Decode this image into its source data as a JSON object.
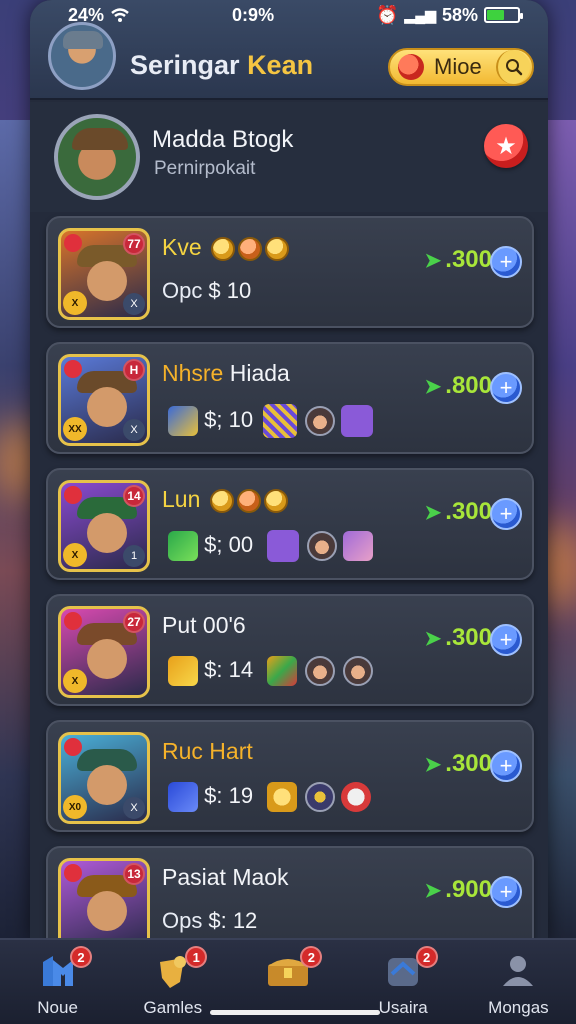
{
  "status_bar": {
    "left": "24%",
    "center": "0:9%",
    "battery": "58%",
    "battery_level": 0.58
  },
  "header": {
    "title_part1": "Seringar",
    "title_part2": "Kean",
    "mode_label": "Mioe",
    "mode_icon": "mode-icon",
    "search_icon": "search-icon"
  },
  "profile": {
    "name": "Madda Btogk",
    "subtitle": "Pernirpokait",
    "star_icon": "star-icon"
  },
  "cards": [
    {
      "title": "Kve",
      "title_color": "#f5d442",
      "ops_label": "Opc",
      "price": "$ 10",
      "points": ".300",
      "thumb_bg": "#d8742a",
      "hat_color": "#7a5a2a",
      "badge_tr": "77",
      "badge_bl": "X",
      "badge_br": "X",
      "extras": "coins3"
    },
    {
      "title": "Nhsre",
      "title2": "Hiada",
      "title_color": "#f5b22a",
      "ops_label": "",
      "price": "$; 10",
      "points": ".800",
      "thumb_bg": "#5a7ad8",
      "hat_color": "#6a4a2a",
      "badge_tr": "H",
      "badge_bl": "XX",
      "badge_br": "X",
      "extras": "tiles1"
    },
    {
      "title": "Lun",
      "title_color": "#f5d442",
      "ops_label": "",
      "price": "$; 00",
      "points": ".300",
      "thumb_bg": "#8a4ad0",
      "hat_color": "#2a6a3a",
      "badge_tr": "14",
      "badge_bl": "X",
      "badge_br": "1",
      "extras": "tiles2"
    },
    {
      "title": "Put 00'6",
      "title_color": "#f2f4f8",
      "ops_label": "",
      "price": "$: 14",
      "points": ".300",
      "thumb_bg": "#d84ab0",
      "hat_color": "#7a4a2a",
      "badge_tr": "27",
      "badge_bl": "X",
      "badge_br": "",
      "extras": "tiles3"
    },
    {
      "title": "Ruc Hart",
      "title_color": "#f5b22a",
      "ops_label": "",
      "price": "$: 19",
      "points": ".300",
      "thumb_bg": "#4ab0d8",
      "hat_color": "#2a5a4a",
      "badge_tr": "",
      "badge_bl": "X0",
      "badge_br": "X",
      "extras": "tiles4"
    },
    {
      "title": "Pasiat Maok",
      "title_color": "#f2f4f8",
      "ops_label": "Ops",
      "price": "$: 12",
      "points": ".900",
      "thumb_bg": "#b05ad8",
      "hat_color": "#8a5a1a",
      "badge_tr": "13",
      "badge_bl": "",
      "badge_br": "",
      "extras": ""
    }
  ],
  "bottom_nav": [
    {
      "label": "Noue",
      "badge": "2",
      "icon": "home-icon"
    },
    {
      "label": "Gamles",
      "badge": "1",
      "icon": "games-icon"
    },
    {
      "label": "",
      "badge": "2",
      "icon": "treasure-chest-icon"
    },
    {
      "label": "Usaira",
      "badge": "2",
      "icon": "inbox-icon"
    },
    {
      "label": "Mongas",
      "badge": "",
      "icon": "profile-icon"
    }
  ]
}
